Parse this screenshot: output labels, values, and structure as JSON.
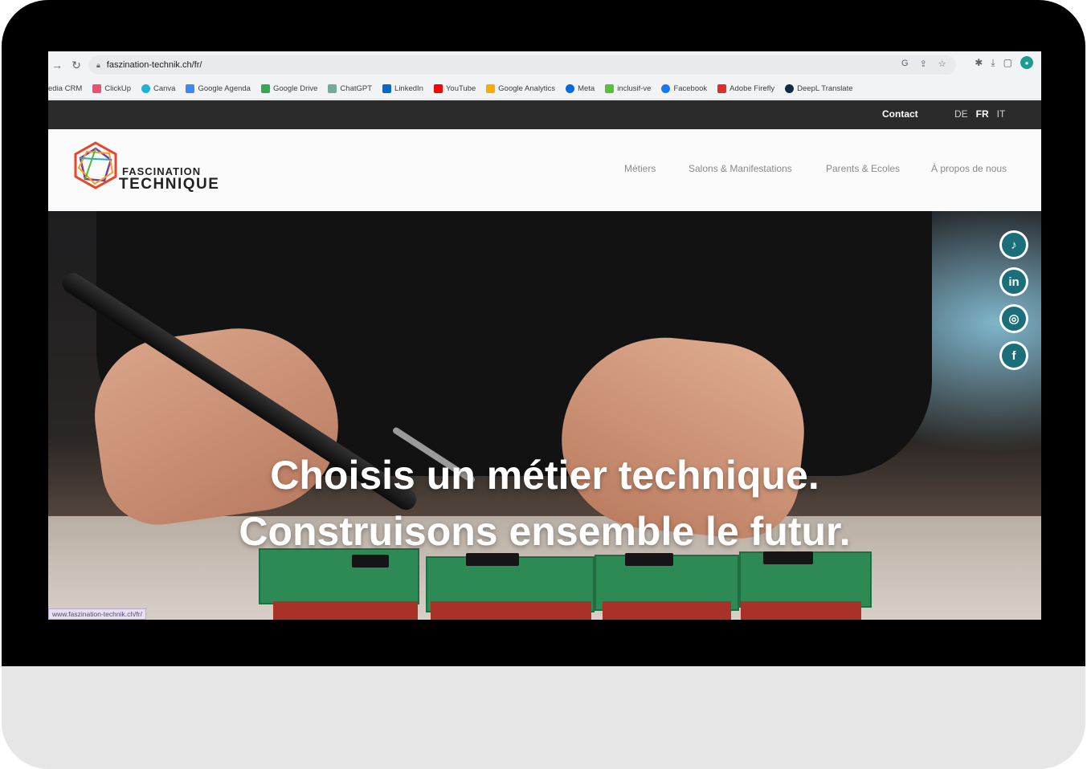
{
  "browser": {
    "url": "faszination-technik.ch/fr/",
    "bookmarks": [
      "edia CRM",
      "ClickUp",
      "Canva",
      "Google Agenda",
      "Google Drive",
      "ChatGPT",
      "LinkedIn",
      "YouTube",
      "Google Analytics",
      "Meta",
      "inclusif-ve",
      "Facebook",
      "Adobe Firefly",
      "DeepL Translate"
    ],
    "status_url": "www.faszination-technik.ch/fr/"
  },
  "topbar": {
    "contact": "Contact",
    "langs": [
      "DE",
      "FR",
      "IT"
    ],
    "active_lang": "FR"
  },
  "logo": {
    "line1": "FASCINATION",
    "line2": "TECHNIQUE"
  },
  "menu": [
    "Métiers",
    "Salons & Manifestations",
    "Parents & Ecoles",
    "À propos de nous"
  ],
  "hero": {
    "line1": "Choisis un métier technique.",
    "line2": "Construisons ensemble le futur."
  },
  "social": [
    {
      "name": "tiktok-icon",
      "glyph": "♪"
    },
    {
      "name": "linkedin-icon",
      "glyph": "in"
    },
    {
      "name": "instagram-icon",
      "glyph": "◎"
    },
    {
      "name": "facebook-icon",
      "glyph": "f"
    }
  ],
  "colors": {
    "topbar": "#2b2b2b",
    "social_teal": "#1a6f7a"
  }
}
